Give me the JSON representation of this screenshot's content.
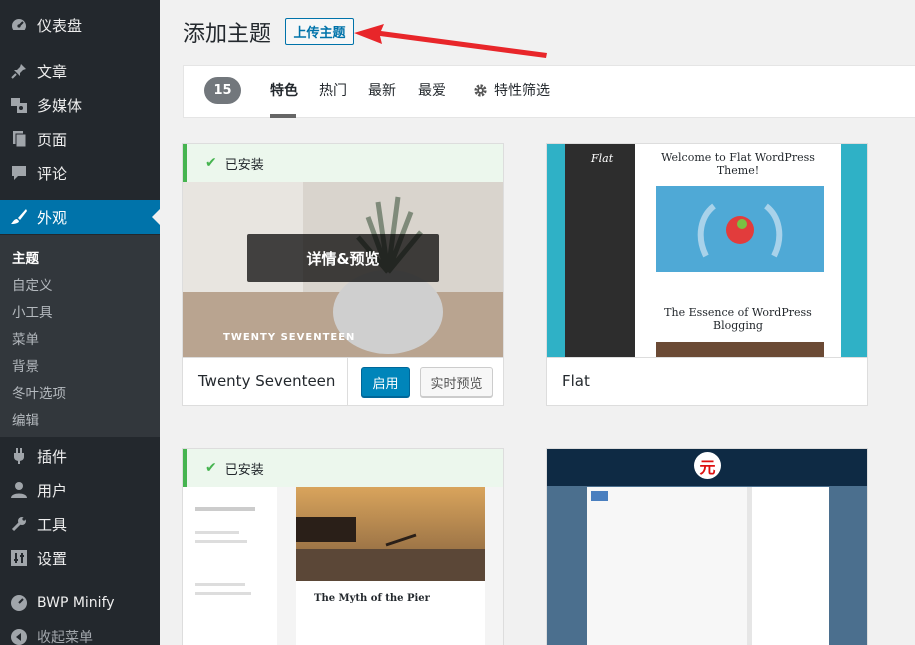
{
  "sidebar": {
    "items": [
      {
        "label": "仪表盘",
        "icon": "dashboard-icon"
      },
      {
        "label": "文章",
        "icon": "pin-icon"
      },
      {
        "label": "多媒体",
        "icon": "media-icon"
      },
      {
        "label": "页面",
        "icon": "page-icon"
      },
      {
        "label": "评论",
        "icon": "comment-icon"
      },
      {
        "label": "外观",
        "icon": "brush-icon"
      },
      {
        "label": "插件",
        "icon": "plugin-icon"
      },
      {
        "label": "用户",
        "icon": "user-icon"
      },
      {
        "label": "工具",
        "icon": "wrench-icon"
      },
      {
        "label": "设置",
        "icon": "settings-icon"
      },
      {
        "label": "BWP Minify",
        "icon": "gauge-icon"
      },
      {
        "label": "收起菜单",
        "icon": "collapse-icon"
      }
    ],
    "submenu": [
      "主题",
      "自定义",
      "小工具",
      "菜单",
      "背景",
      "冬叶选项",
      "编辑"
    ]
  },
  "header": {
    "title": "添加主题",
    "upload_label": "上传主题"
  },
  "filter": {
    "count": "15",
    "tabs": [
      "特色",
      "热门",
      "最新",
      "最爱"
    ],
    "feature_filter": "特性筛选"
  },
  "themes": [
    {
      "name": "Twenty Seventeen",
      "installed": "已安装",
      "overlay": "详情&预览",
      "activate": "启用",
      "preview": "实时预览",
      "shot_text": "TWENTY SEVENTEEN"
    },
    {
      "name": "Flat",
      "shot_title": "Welcome to Flat WordPress Theme!",
      "shot_subtitle": "The Essence of WordPress Blogging",
      "shot_logo": "Flat"
    },
    {
      "installed": "已安装",
      "shot_title": "The Myth of the Pier"
    },
    {
      "shot_logo": "元"
    }
  ],
  "colors": {
    "sidebar_bg": "#23282d",
    "accent": "#0073aa",
    "installed_green": "#46b450",
    "arrow_red": "#e8262a"
  }
}
